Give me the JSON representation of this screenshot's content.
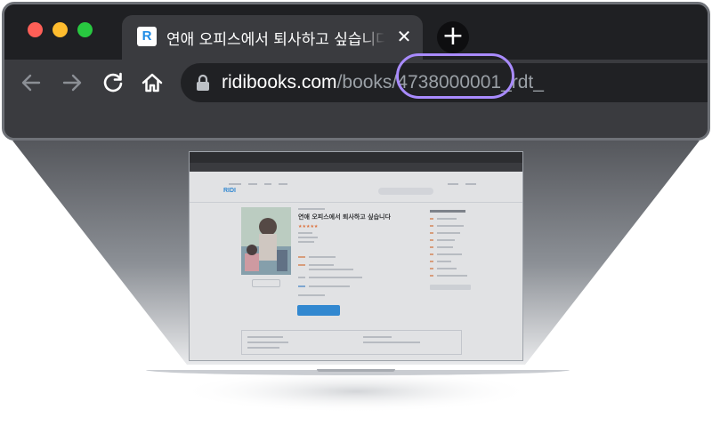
{
  "browser": {
    "tab": {
      "favicon_letter": "R",
      "title": "연애 오피스에서 퇴사하고 싶습니다 - 리디",
      "close_glyph": "✕"
    },
    "new_tab_glyph": "+",
    "address_bar": {
      "domain": "ridibooks.com",
      "path_prefix": "/books/",
      "book_id": "4738000001",
      "path_suffix": "_rdt_",
      "highlight_color": "#a98bff"
    }
  },
  "page_preview": {
    "logo": "RIDI",
    "book_title": "연애 오피스에서 퇴사하고 싶습니다",
    "rating_stars": "★★★★★",
    "buy_button_label": "",
    "preview_button_label": ""
  },
  "colors": {
    "chrome_bg": "#2f3033",
    "toolbar_bg": "#3a3b3f",
    "omnibox_bg": "#202124",
    "ridi_blue": "#1f8ce6"
  }
}
